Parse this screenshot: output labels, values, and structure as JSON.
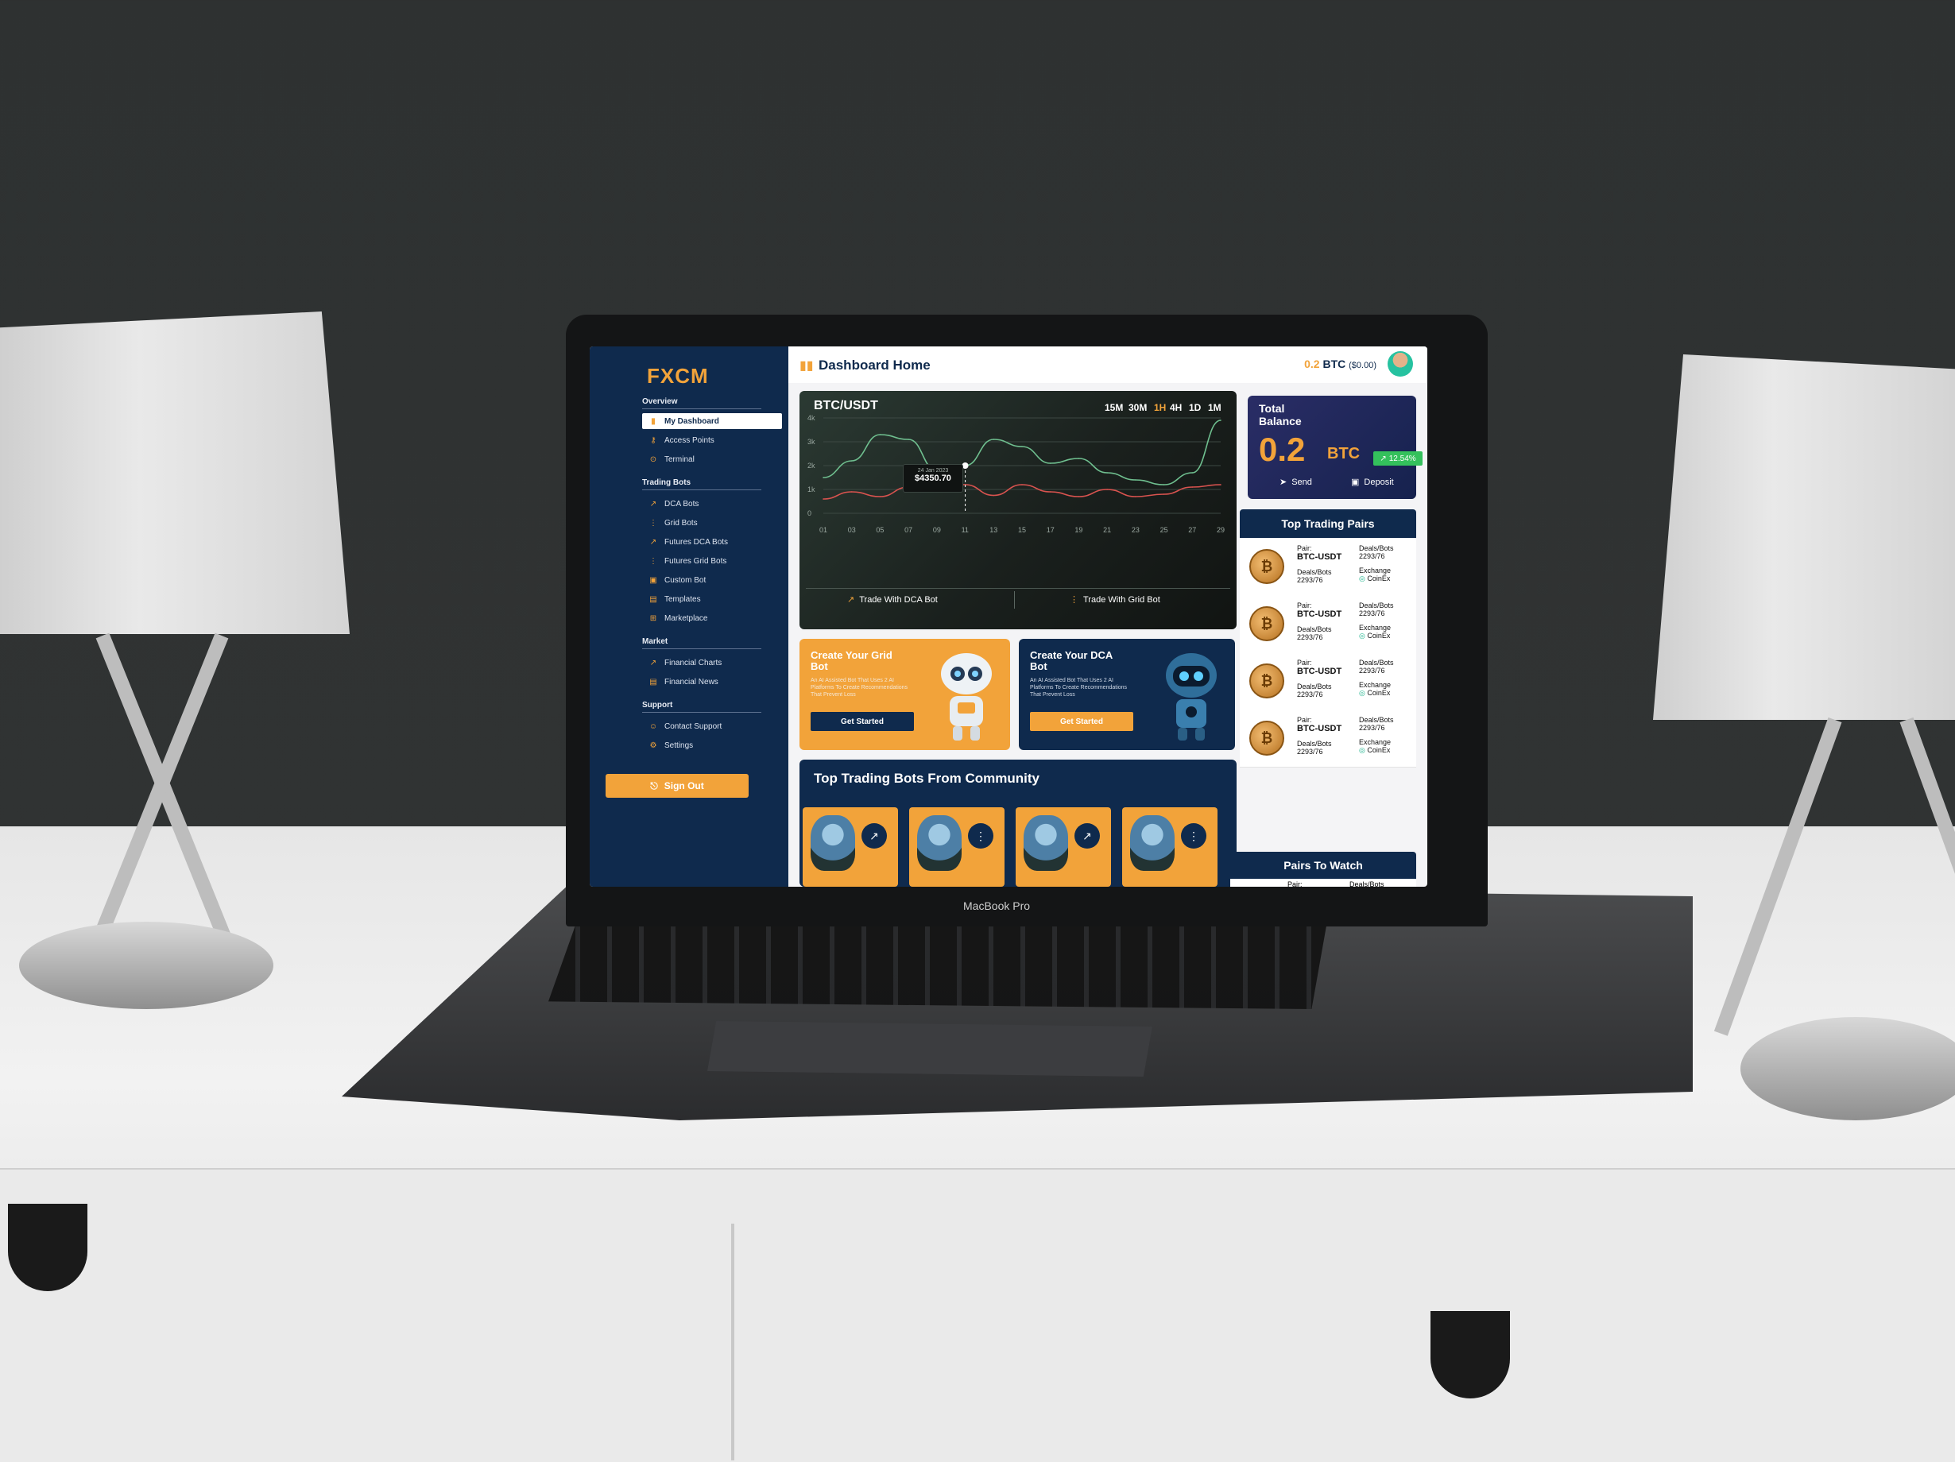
{
  "laptop": {
    "brand": "MacBook Pro"
  },
  "sidebar": {
    "logo": "FXCM",
    "sections": {
      "overview": "Overview",
      "trading_bots": "Trading Bots",
      "market": "Market",
      "support": "Support"
    },
    "items": [
      {
        "label": "My Dashboard",
        "icon": "bar-chart-icon",
        "active": true
      },
      {
        "label": "Access Points",
        "icon": "key-icon"
      },
      {
        "label": "Terminal",
        "icon": "terminal-icon"
      },
      {
        "label": "DCA Bots",
        "icon": "trend-icon"
      },
      {
        "label": "Grid Bots",
        "icon": "grid-bot-icon"
      },
      {
        "label": "Futures DCA Bots",
        "icon": "trend-icon"
      },
      {
        "label": "Futures Grid Bots",
        "icon": "grid-bot-icon"
      },
      {
        "label": "Custom Bot",
        "icon": "custom-bot-icon"
      },
      {
        "label": "Templates",
        "icon": "template-icon"
      },
      {
        "label": "Marketplace",
        "icon": "cart-icon"
      },
      {
        "label": "Financial Charts",
        "icon": "chart-icon"
      },
      {
        "label": "Financial News",
        "icon": "news-icon"
      },
      {
        "label": "Contact Support",
        "icon": "user-icon"
      },
      {
        "label": "Settings",
        "icon": "gear-icon"
      }
    ],
    "sign_out": "Sign Out"
  },
  "header": {
    "title": "Dashboard Home",
    "balance_amount": "0.2",
    "balance_unit": "BTC",
    "balance_usd": "($0.00)"
  },
  "chart": {
    "pair": "BTC/USDT",
    "timeframes": [
      "15M",
      "30M",
      "1H",
      "4H",
      "1D",
      "1M"
    ],
    "selected_timeframe": "1H",
    "tooltip_date": "24 Jan 2023",
    "tooltip_value": "$4350.70",
    "trade_dca": "Trade With DCA Bot",
    "trade_grid": "Trade With Grid Bot"
  },
  "chart_data": {
    "type": "line",
    "x": [
      "01",
      "03",
      "05",
      "07",
      "09",
      "11",
      "13",
      "15",
      "17",
      "19",
      "21",
      "23",
      "25",
      "27",
      "29"
    ],
    "ytick_labels": [
      "0",
      "1k",
      "2k",
      "3k",
      "4k"
    ],
    "ylim": [
      0,
      4000
    ],
    "series": [
      {
        "color": "#6fbf8f",
        "values": [
          1500,
          2200,
          3300,
          3100,
          1800,
          2000,
          3100,
          2800,
          2100,
          2300,
          1700,
          1400,
          1200,
          1700,
          3900
        ]
      },
      {
        "color": "#d9534f",
        "values": [
          600,
          900,
          700,
          1100,
          1200,
          1200,
          750,
          1200,
          900,
          700,
          1000,
          700,
          800,
          1100,
          1200
        ]
      }
    ],
    "grid": true
  },
  "promos": [
    {
      "title": "Create Your Grid Bot",
      "desc": "An AI Assisted Bot That Uses 2 AI Platforms To Create Recommendations That Prevent Loss",
      "button": "Get Started"
    },
    {
      "title": "Create Your DCA Bot",
      "desc": "An AI Assisted Bot That Uses 2 AI Platforms To Create Recommendations That Prevent Loss",
      "button": "Get Started"
    }
  ],
  "community": {
    "title": "Top Trading Bots From Community"
  },
  "total_balance": {
    "label": "Total Balance",
    "value": "0.2",
    "unit": "BTC",
    "change": "12.54%",
    "send": "Send",
    "deposit": "Deposit"
  },
  "top_pairs": {
    "title": "Top Trading Pairs",
    "rows": [
      {
        "pair_label": "Pair:",
        "pair": "BTC-USDT",
        "deals_label": "Deals/Bots",
        "deals": "2293/76",
        "deals_label2": "Deals/Bots",
        "deals2": "2293/76",
        "exchange_label": "Exchange",
        "exchange": "CoinEx"
      },
      {
        "pair_label": "Pair:",
        "pair": "BTC-USDT",
        "deals_label": "Deals/Bots",
        "deals": "2293/76",
        "deals_label2": "Deals/Bots",
        "deals2": "2293/76",
        "exchange_label": "Exchange",
        "exchange": "CoinEx"
      },
      {
        "pair_label": "Pair:",
        "pair": "BTC-USDT",
        "deals_label": "Deals/Bots",
        "deals": "2293/76",
        "deals_label2": "Deals/Bots",
        "deals2": "2293/76",
        "exchange_label": "Exchange",
        "exchange": "CoinEx"
      },
      {
        "pair_label": "Pair:",
        "pair": "BTC-USDT",
        "deals_label": "Deals/Bots",
        "deals": "2293/76",
        "deals_label2": "Deals/Bots",
        "deals2": "2293/76",
        "exchange_label": "Exchange",
        "exchange": "CoinEx"
      }
    ]
  },
  "watch": {
    "title": "Pairs To Watch",
    "row": {
      "pair_label": "Pair:",
      "deals_label": "Deals/Bots"
    }
  }
}
